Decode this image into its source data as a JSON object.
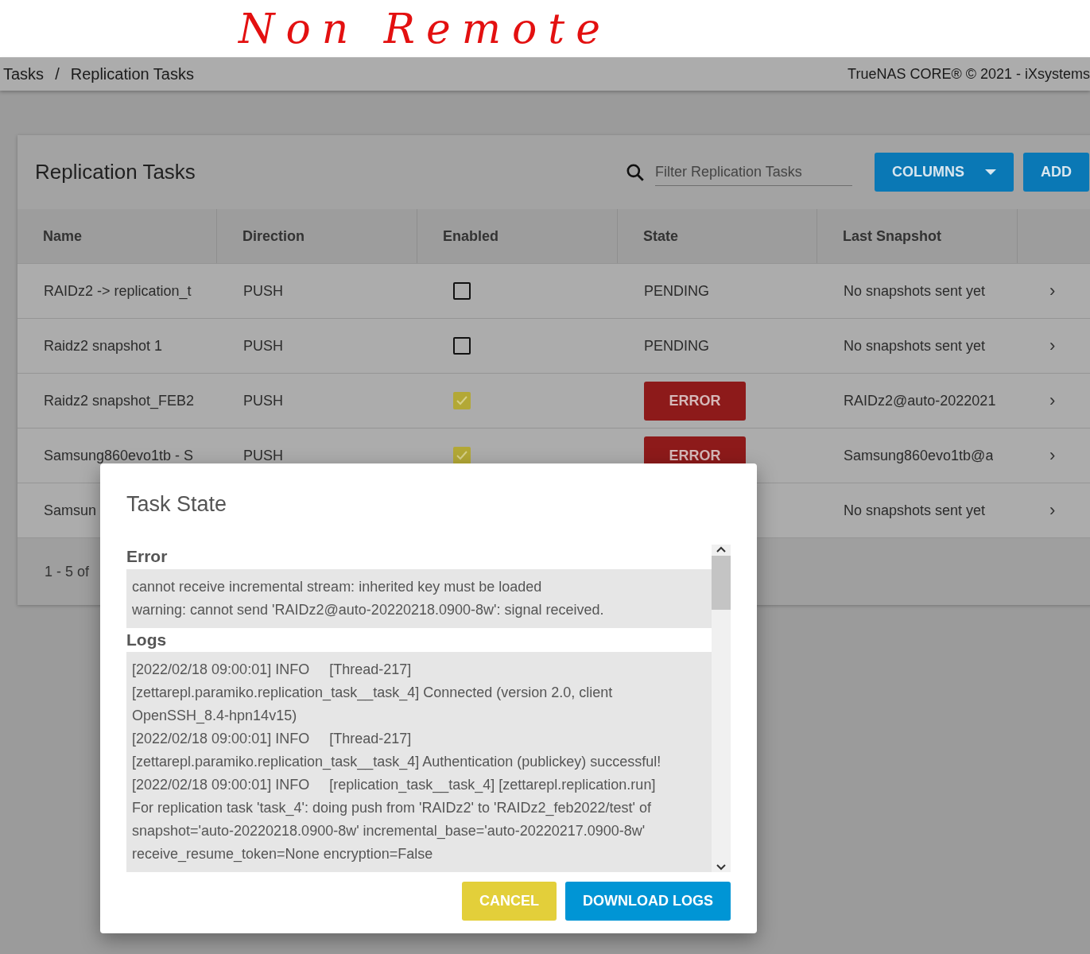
{
  "annotation": "Non Remote",
  "breadcrumb": [
    "Tasks",
    "Replication Tasks"
  ],
  "breadcrumb_separator": "/",
  "copyright": "TrueNAS CORE® © 2021 - iXsystems",
  "card": {
    "title": "Replication Tasks",
    "search": {
      "placeholder": "Filter Replication Tasks"
    },
    "buttons": [
      "COLUMNS",
      "ADD"
    ]
  },
  "table": {
    "columns": [
      "Name",
      "Direction",
      "Enabled",
      "State",
      "Last Snapshot"
    ],
    "rows": [
      {
        "name": "RAIDz2 -> replication_t",
        "direction": "PUSH",
        "enabled": false,
        "state": {
          "kind": "text",
          "label": "PENDING"
        },
        "last_snapshot": "No snapshots sent yet",
        "chevron": "›"
      },
      {
        "name": "Raidz2 snapshot 1",
        "direction": "PUSH",
        "enabled": false,
        "state": {
          "kind": "text",
          "label": "PENDING"
        },
        "last_snapshot": "No snapshots sent yet",
        "chevron": "›"
      },
      {
        "name": "Raidz2 snapshot_FEB2",
        "direction": "PUSH",
        "enabled": true,
        "state": {
          "kind": "error",
          "label": "ERROR"
        },
        "last_snapshot": "RAIDz2@auto-2022021",
        "chevron": "›"
      },
      {
        "name": "Samsung860evo1tb - S",
        "direction": "PUSH",
        "enabled": true,
        "state": {
          "kind": "error",
          "label": "ERROR"
        },
        "last_snapshot": "Samsung860evo1tb@a",
        "chevron": "›"
      },
      {
        "name": "Samsun",
        "last_snapshot": "No snapshots sent yet",
        "chevron": "›"
      }
    ],
    "footer": "1 - 5 of"
  },
  "dialog": {
    "title": "Task State",
    "error_heading": "Error",
    "error_lines": [
      "cannot receive incremental stream: inherited key must be loaded",
      "warning: cannot send 'RAIDz2@auto-20220218.0900-8w': signal received."
    ],
    "logs_heading": "Logs",
    "log_lines": [
      "[2022/02/18 09:00:01] INFO     [Thread-217]",
      "[zettarepl.paramiko.replication_task__task_4] Connected (version 2.0, client",
      "OpenSSH_8.4-hpn14v15)",
      "[2022/02/18 09:00:01] INFO     [Thread-217]",
      "[zettarepl.paramiko.replication_task__task_4] Authentication (publickey) successful!",
      "[2022/02/18 09:00:01] INFO     [replication_task__task_4] [zettarepl.replication.run]",
      "For replication task 'task_4': doing push from 'RAIDz2' to 'RAIDz2_feb2022/test' of",
      "snapshot='auto-20220218.0900-8w' incremental_base='auto-20220217.0900-8w'",
      "receive_resume_token=None encryption=False"
    ],
    "buttons": [
      {
        "kind": "cancel",
        "label": "CANCEL"
      },
      {
        "kind": "primary",
        "label": "DOWNLOAD LOGS"
      }
    ]
  }
}
